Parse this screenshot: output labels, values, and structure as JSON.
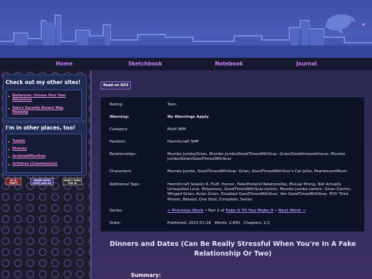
{
  "nav": {
    "items": [
      "Home",
      "Sketchbook",
      "Notebook",
      "Journal"
    ]
  },
  "sidebar": {
    "sites_title": "Check out my other sites!",
    "sites": [
      "Deltarune: Choose Your Own Adventure",
      "Rain's Security Breach Map Rewamp"
    ],
    "places_title": "I'm in other places, too!",
    "places": [
      "Tumblr",
      "Bluesky",
      "ArchiveOfOurOwn",
      "Artistree (Commissions)"
    ],
    "badges": [
      "AI IS THEFT",
      "MADE WITH LOVE (not AI)",
      "DON'T FEED THE AI"
    ]
  },
  "work": {
    "ao3_button": "Read on AO3",
    "meta": [
      {
        "label": "Rating:",
        "value": "Teen"
      },
      {
        "label": "Warning:",
        "value": "No Warnings Apply"
      },
      {
        "label": "Category:",
        "value": "Multi M/M"
      },
      {
        "label": "Fandom:",
        "value": "Hermitcraft SMP"
      },
      {
        "label": "Relationships:",
        "value": "Mumbo Jumbo/Grian, Mumbo Jumbo/GoodTimesWithScar, Grian/Goodtimeswithscar, Mumbo Jumbo/Grian/GoodTimesWithScar"
      },
      {
        "label": "Characters:",
        "value": "Mumbo Jumbo, GoodTimesWithScar, Grian, GoodTimesWithScar's Cat Jellie, PearlescentMoon"
      },
      {
        "label": "Additional Tags:",
        "value": "Hermitcraft Season 6, Fluff, Humor, Fake/Pretend Relationship, Mutual Pining, Not Actually Unrequited Love, Polyamory, GoodTimesWithScar-centric, Mumbo Jumbo-centric, Grian-Centric, Winged Grian, Avian Grian, Disabled GoodTimesWithScar, Vex GoodTimesWithScar, POV Third Person, Betaed, One Shot, Complete, Series"
      },
      {
        "label": "Series:",
        "value": ""
      },
      {
        "label": "Stats:",
        "value": ""
      }
    ],
    "series": {
      "prev": "← Previous Work",
      "middle": " • Part 2 of ",
      "series_name": "Fake It Til You Make It",
      "sep": " • ",
      "next": "Next Work →"
    },
    "stats": {
      "published_label": "Published:",
      "published": "2023-01-18",
      "words_label": "Words:",
      "words": "2,895",
      "chapters_label": "Chapters:",
      "chapters": "1/1"
    },
    "title": "Dinners and Dates (Can Be Really Stressful When You're In A Fake Relationship Or Two)",
    "summary_label": "Summary:"
  }
}
